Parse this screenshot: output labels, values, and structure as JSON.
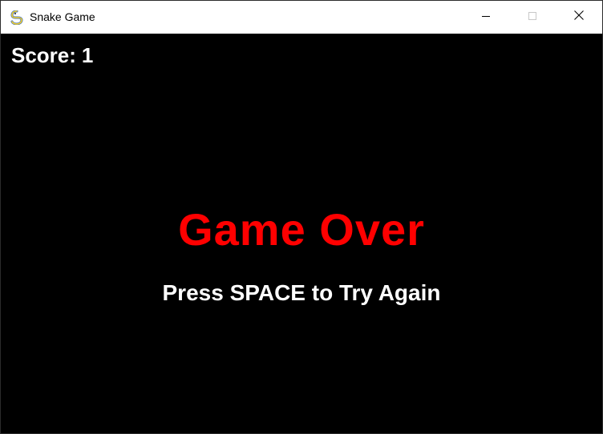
{
  "window": {
    "title": "Snake Game",
    "icon": "pygame-snake-icon",
    "controls": [
      "minimize-icon",
      "maximize-icon",
      "close-icon"
    ]
  },
  "game": {
    "score_label": "Score:",
    "score_value": "1",
    "game_over_text": "Game Over",
    "retry_prompt": "Press SPACE to Try Again"
  },
  "colors": {
    "background": "#000000",
    "game_over": "#ff0000",
    "text": "#ffffff",
    "titlebar": "#ffffff"
  }
}
